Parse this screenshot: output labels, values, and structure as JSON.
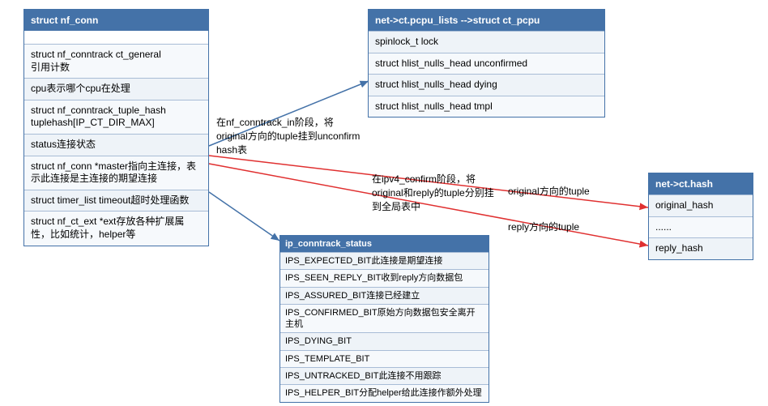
{
  "nf_conn": {
    "title": "struct nf_conn",
    "rows": [
      "struct nf_conntrack ct_general\n引用计数",
      "cpu表示哪个cpu在处理",
      "struct nf_conntrack_tuple_hash tuplehash[IP_CT_DIR_MAX]",
      "status连接状态",
      "struct nf_conn *master指向主连接，表示此连接是主连接的期望连接",
      "struct timer_list timeout超时处理函数",
      "struct nf_ct_ext *ext存放各种扩展属性，比如统计，helper等"
    ]
  },
  "ct_pcpu": {
    "title": "net->ct.pcpu_lists -->struct ct_pcpu",
    "rows": [
      "spinlock_t lock",
      "struct hlist_nulls_head unconfirmed",
      "struct hlist_nulls_head dying",
      "struct hlist_nulls_head tmpl"
    ]
  },
  "status_enum": {
    "title": "ip_conntrack_status",
    "rows": [
      "IPS_EXPECTED_BIT此连接是期望连接",
      "IPS_SEEN_REPLY_BIT收到reply方向数据包",
      "IPS_ASSURED_BIT连接已经建立",
      "IPS_CONFIRMED_BIT原始方向数据包安全离开主机",
      "IPS_DYING_BIT",
      "IPS_TEMPLATE_BIT",
      "IPS_UNTRACKED_BIT此连接不用跟踪",
      "IPS_HELPER_BIT分配helper给此连接作额外处理"
    ]
  },
  "ct_hash": {
    "title": "net->ct.hash",
    "rows": [
      "original_hash",
      "......",
      "reply_hash"
    ]
  },
  "annotations": {
    "a1": "在nf_conntrack_in阶段，将original方向的tuple挂到unconfirm hash表",
    "a2": "在ipv4_confirm阶段，将original和reply的tuple分别挂到全局表中",
    "a3": "original方向的tuple",
    "a4": "reply方向的tuple"
  }
}
